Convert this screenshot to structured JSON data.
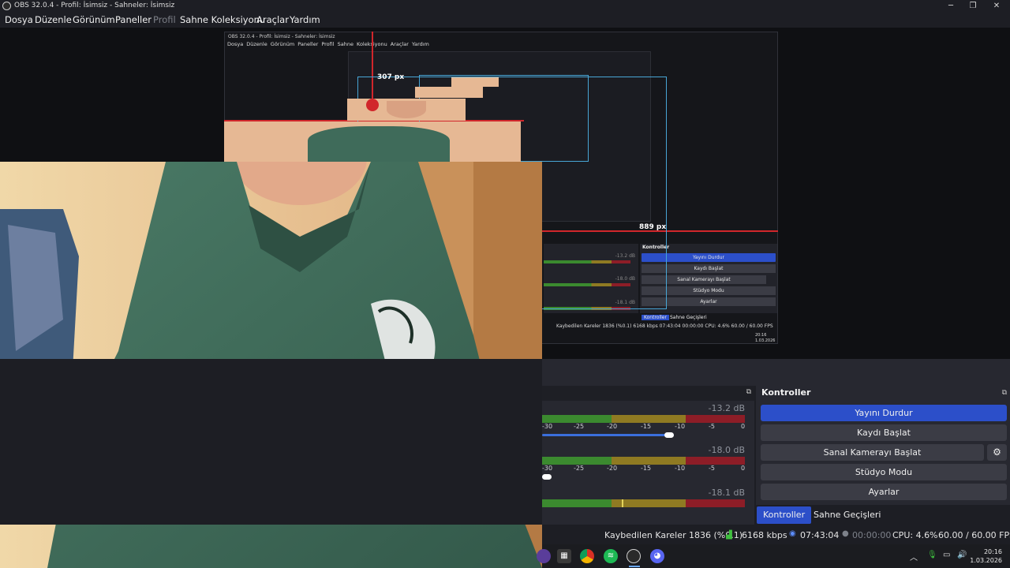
{
  "window": {
    "title": "OBS 32.0.4 - Profil: İsimsiz - Sahneler: İsimsiz",
    "minimize": "─",
    "maximize": "❐",
    "close": "✕"
  },
  "menu": [
    "Dosya",
    "Düzenle",
    "Görünüm",
    "Paneller",
    "Profil",
    "Sahne Koleksiyonu",
    "Araçlar",
    "Yardım"
  ],
  "preview": {
    "nested_title": "OBS 32.0.4 - Profil: İsimsiz - Sahneler: İsimsiz",
    "nested_menu": "Dosya Düzenle Görünüm Paneller Profil Sahne Koleksiyonu Araçlar Yardım",
    "width_label_top": "307 px",
    "width_label_mid": "889 px",
    "mini_controls_title": "Kontroller",
    "mini_buttons": [
      "Yayını Durdur",
      "Kaydı Başlat",
      "Sanal Kamerayı Başlat",
      "Stüdyo Modu",
      "Ayarlar"
    ],
    "mini_db": [
      "-13.2 dB",
      "-18.0 dB",
      "-18.1 dB"
    ],
    "mini_tabs": [
      "Kontroller",
      "Sahne Geçişleri"
    ],
    "mini_status": "Kaybedilen Kareler 1836 (%0.1)   6168 kbps   07:43:04   00:00:00   CPU: 4.6%   60.00 / 60.00 FPS",
    "mini_clock_time": "20:16",
    "mini_clock_date": "1.03.2026"
  },
  "mixer": {
    "channels": [
      {
        "db": "-13.2 dB",
        "level": 0.95,
        "volume": 0.65
      },
      {
        "db": "-18.0 dB",
        "level": 0.95,
        "volume": 0.03
      },
      {
        "db": "-18.1 dB",
        "level": 0.95,
        "volume": null
      }
    ],
    "scale": [
      "-30",
      "-25",
      "-20",
      "-15",
      "-10",
      "-5",
      "0"
    ]
  },
  "controls": {
    "title": "Kontroller",
    "dock_icon": "⧉",
    "stop_stream": "Yayını Durdur",
    "start_record": "Kaydı Başlat",
    "start_virtualcam": "Sanal Kamerayı Başlat",
    "studio_mode": "Stüdyo Modu",
    "settings": "Ayarlar",
    "gear": "⚙"
  },
  "tabs": [
    "Kontroller",
    "Sahne Geçişleri"
  ],
  "status": {
    "dropped_frames": "Kaybedilen Kareler 1836 (%0.1)",
    "bitrate": "6168 kbps",
    "stream_time": "07:43:04",
    "record_time": "00:00:00",
    "cpu": "CPU: 4.6%",
    "fps": "60.00 / 60.00 FPS"
  },
  "clock": {
    "time": "20:16",
    "date": "1.03.2026"
  },
  "colors": {
    "accent": "#2c4fc9",
    "meter_green": "#3b8a2f",
    "meter_yellow": "#8f7a22",
    "meter_red": "#8d1d27",
    "guide_red": "#d1262b",
    "guide_blue": "#48a6d6"
  }
}
